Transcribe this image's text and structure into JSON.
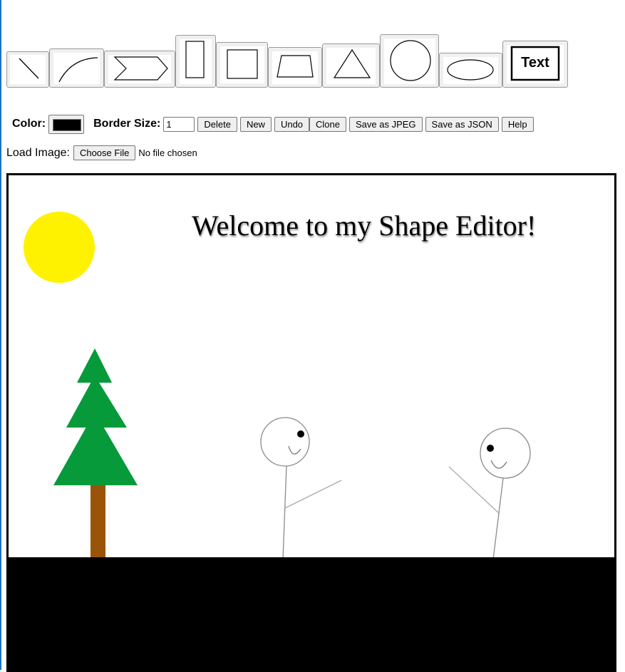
{
  "shape_palette": {
    "tools": [
      {
        "name": "line-tool",
        "icon": "line-icon"
      },
      {
        "name": "curve-tool",
        "icon": "curve-icon"
      },
      {
        "name": "arrow-tool",
        "icon": "arrow-pentagon-icon"
      },
      {
        "name": "rectangle-tool",
        "icon": "tall-rectangle-icon"
      },
      {
        "name": "square-tool",
        "icon": "square-icon"
      },
      {
        "name": "trapezoid-tool",
        "icon": "trapezoid-icon"
      },
      {
        "name": "triangle-tool",
        "icon": "triangle-icon"
      },
      {
        "name": "circle-tool",
        "icon": "circle-icon"
      },
      {
        "name": "ellipse-tool",
        "icon": "ellipse-icon"
      },
      {
        "name": "text-tool",
        "icon": "text-icon",
        "label": "Text"
      }
    ]
  },
  "controls": {
    "color_label": "Color:",
    "color_value": "#000000",
    "border_size_label": "Border Size:",
    "border_size_value": "1",
    "buttons": {
      "delete": "Delete",
      "new": "New",
      "undo": "Undo",
      "clone": "Clone",
      "save_jpeg": "Save as JPEG",
      "save_json": "Save as JSON",
      "help": "Help"
    }
  },
  "load_image": {
    "label": "Load Image:",
    "button": "Choose File",
    "status": "No file chosen"
  },
  "canvas": {
    "title_text": "Welcome to my Shape Editor!",
    "colors": {
      "sun": "#fff200",
      "tree": "#079a3a",
      "trunk": "#9a5408",
      "ground": "#000000",
      "stick_figure": "#8a8a8a"
    }
  }
}
